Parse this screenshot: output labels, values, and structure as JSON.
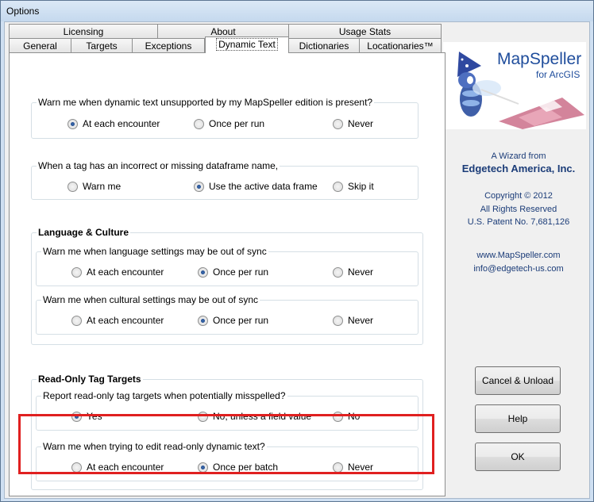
{
  "window": {
    "title": "Options"
  },
  "tabs_row1": [
    "Licensing",
    "About",
    "Usage Stats"
  ],
  "tabs_row2": [
    "General",
    "Targets",
    "Exceptions",
    "Dynamic Text",
    "Dictionaries",
    "Locationaries™"
  ],
  "active_tab": "Dynamic Text",
  "dynamic_text": {
    "unsupported": {
      "title": "Warn me when dynamic text unsupported by my MapSpeller edition is present?",
      "options": [
        "At each encounter",
        "Once per run",
        "Never"
      ],
      "selected": "At each encounter"
    },
    "dataframe": {
      "title": "When a tag has an incorrect or missing dataframe name,",
      "options": [
        "Warn me",
        "Use the active data frame",
        "Skip it"
      ],
      "selected": "Use the active data frame"
    },
    "language_culture": {
      "title": "Language & Culture",
      "language": {
        "title": "Warn me when language settings may be out of sync",
        "options": [
          "At each encounter",
          "Once per run",
          "Never"
        ],
        "selected": "Once per run"
      },
      "cultural": {
        "title": "Warn me when cultural settings may be out of sync",
        "options": [
          "At each encounter",
          "Once per run",
          "Never"
        ],
        "selected": "Once per run"
      }
    },
    "read_only": {
      "title": "Read-Only Tag Targets",
      "report": {
        "title": "Report read-only tag targets when potentially misspelled?",
        "options": [
          "Yes",
          "No, unless a field value",
          "No"
        ],
        "selected": "Yes"
      },
      "edit": {
        "title": "Warn me when trying to edit read-only dynamic text?",
        "options": [
          "At each encounter",
          "Once per batch",
          "Never"
        ],
        "selected": "Once per batch"
      }
    }
  },
  "logo": {
    "name": "MapSpeller",
    "subtitle": "for ArcGIS",
    "name_color": "#1f4d9c"
  },
  "info": {
    "wizard": "A Wizard from",
    "company": "Edgetech America, Inc.",
    "copyright": "Copyright © 2012",
    "rights": "All Rights Reserved",
    "patent": "U.S. Patent No. 7,681,126",
    "website": "www.MapSpeller.com",
    "email": "info@edgetech-us.com"
  },
  "buttons": {
    "cancel": "Cancel & Unload",
    "help": "Help",
    "ok": "OK"
  },
  "highlight_color": "#e02020"
}
